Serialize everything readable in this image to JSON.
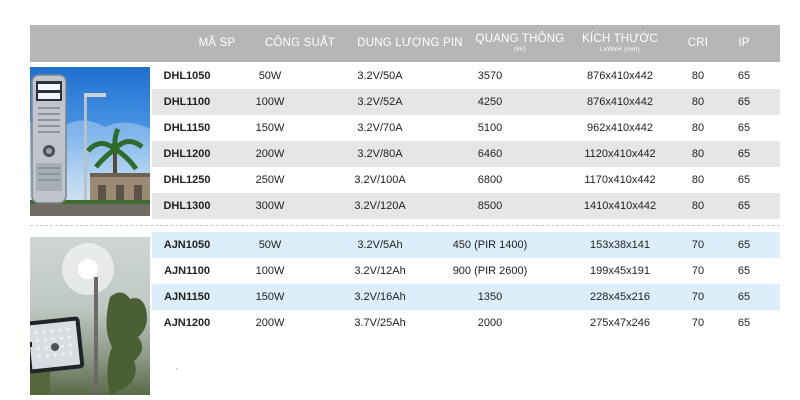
{
  "headers": [
    {
      "main": "MÃ SP",
      "sub": ""
    },
    {
      "main": "CÔNG SUẤT",
      "sub": ""
    },
    {
      "main": "DUNG LƯỢNG PIN",
      "sub": ""
    },
    {
      "main": "QUANG THÔNG",
      "sub": "(lm)"
    },
    {
      "main": "KÍCH THƯỚC",
      "sub": "LxWxH (mm)"
    },
    {
      "main": "CRI",
      "sub": ""
    },
    {
      "main": "IP",
      "sub": ""
    }
  ],
  "groups": [
    {
      "rows": [
        [
          "DHL1050",
          "50W",
          "3.2V/50A",
          "3570",
          "876x410x442",
          "80",
          "65"
        ],
        [
          "DHL1100",
          "100W",
          "3.2V/52A",
          "4250",
          "876x410x442",
          "80",
          "65"
        ],
        [
          "DHL1150",
          "150W",
          "3.2V/70A",
          "5100",
          "962x410x442",
          "80",
          "65"
        ],
        [
          "DHL1200",
          "200W",
          "3.2V/80A",
          "6460",
          "1120x410x442",
          "80",
          "65"
        ],
        [
          "DHL1250",
          "250W",
          "3.2V/100A",
          "6800",
          "1170x410x442",
          "80",
          "65"
        ],
        [
          "DHL1300",
          "300W",
          "3.2V/120A",
          "8500",
          "1410x410x442",
          "80",
          "65"
        ]
      ]
    },
    {
      "rows": [
        [
          "AJN1050",
          "50W",
          "3.2V/5Ah",
          "450 (PIR 1400)",
          "153x38x141",
          "70",
          "65"
        ],
        [
          "AJN1100",
          "100W",
          "3.2V/12Ah",
          "900 (PIR 2600)",
          "199x45x191",
          "70",
          "65"
        ],
        [
          "AJN1150",
          "150W",
          "3.2V/16Ah",
          "1350",
          "228x45x216",
          "70",
          "65"
        ],
        [
          "AJN1200",
          "200W",
          "3.7V/25Ah",
          "2000",
          "275x47x246",
          "70",
          "65"
        ]
      ]
    }
  ],
  "colors": {
    "header_bg": "#b6b6b6",
    "row_grey": "#e6e6e6",
    "row_blue": "#dbeefa"
  },
  "images": [
    "solar-street-light-photo",
    "solar-flood-light-photo"
  ]
}
